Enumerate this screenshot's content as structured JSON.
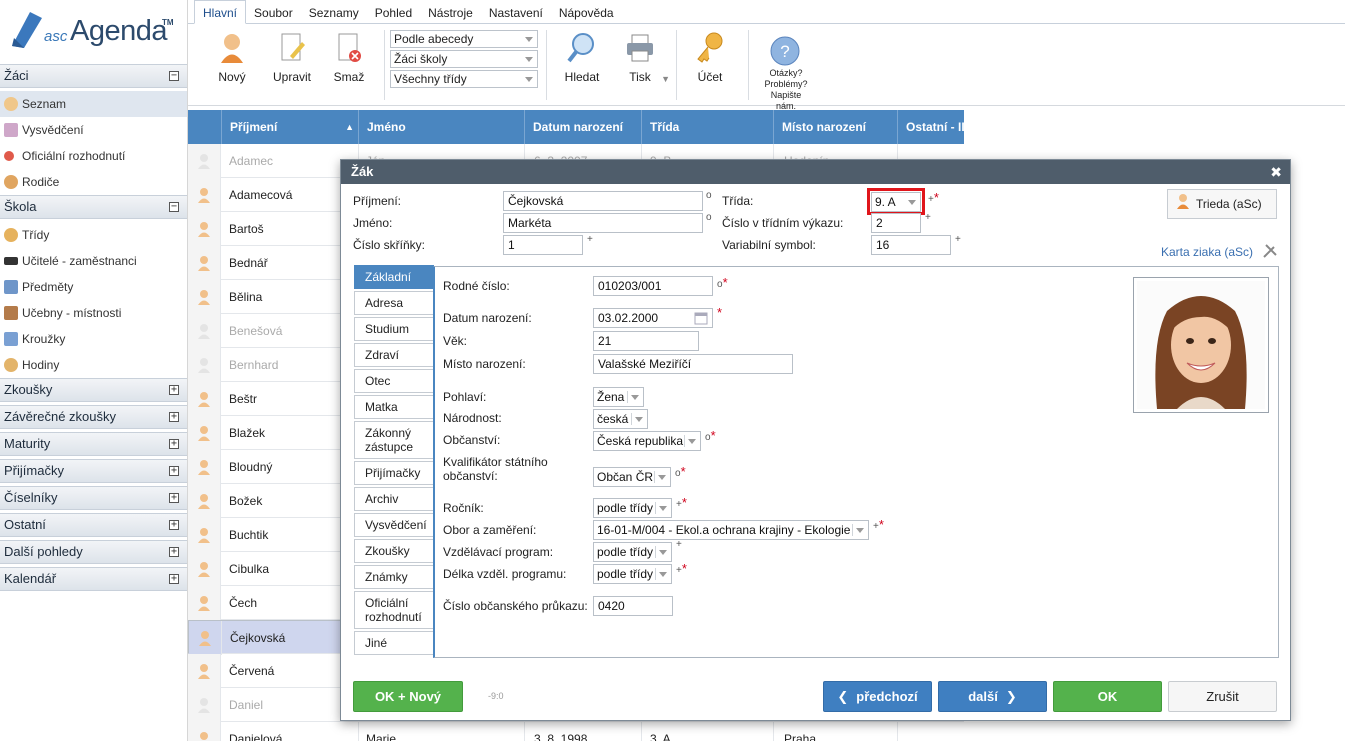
{
  "logo": {
    "prefix": "asc",
    "name": "Agenda",
    "tm": "TM"
  },
  "menu": {
    "tabs": [
      "Hlavní",
      "Soubor",
      "Seznamy",
      "Pohled",
      "Nástroje",
      "Nastavení",
      "Nápověda"
    ]
  },
  "ribbon": {
    "new": "Nový",
    "edit": "Upravit",
    "delete": "Smaž",
    "filters": [
      "Podle abecedy",
      "Žáci školy",
      "Všechny třídy"
    ],
    "search": "Hledat",
    "print": "Tisk",
    "account": "Účet",
    "help": [
      "Otázky?",
      "Problémy?",
      "Napište nám."
    ]
  },
  "sidebar": {
    "zaci": {
      "title": "Žáci",
      "toggle": "−",
      "items": [
        "Seznam",
        "Vysvědčení",
        "Oficiální rozhodnutí",
        "Rodiče"
      ]
    },
    "skola": {
      "title": "Škola",
      "toggle": "−",
      "items": [
        "Třídy",
        "Učitelé - zaměstnanci",
        "Předměty",
        "Učebny - místnosti",
        "Kroužky",
        "Hodiny"
      ]
    },
    "collapsed": [
      "Zkoušky",
      "Závěrečné zkoušky",
      "Maturity",
      "Přijímačky",
      "Číselníky",
      "Ostatní",
      "Další pohledy",
      "Kalendář"
    ],
    "expand_symbol": "+"
  },
  "grid": {
    "headers": [
      "Příjmení",
      "Jméno",
      "Datum narození",
      "Třída",
      "Místo narození",
      "Ostatní - II"
    ],
    "sort_indicator": "▲",
    "rows": [
      "Adamec",
      "Adamecová",
      "Bartoš",
      "Bednář",
      "Bělina",
      "Benešová",
      "Bernhard",
      "Beštr",
      "Blažek",
      "Bloudný",
      "Božek",
      "Buchtik",
      "Cibulka",
      "Čech",
      "Čejkovská",
      "Červená",
      "Daniel",
      "Danielová"
    ],
    "first_row_partial": [
      "Ján",
      "6. 3. 2007",
      "9. B",
      "Hodonín"
    ],
    "last_row": [
      "Marie",
      "3. 8. 1998",
      "3. A",
      "Praha"
    ]
  },
  "dialog": {
    "title": "Žák",
    "close": "✖",
    "prijmeni_label": "Příjmení:",
    "prijmeni": "Čejkovská",
    "jmeno_label": "Jméno:",
    "jmeno": "Markéta",
    "skrinka_label": "Číslo skříňky:",
    "skrinka": "1",
    "trida_label": "Třída:",
    "trida": "9. A",
    "cislo_vykaz_label": "Číslo v třídním výkazu:",
    "cislo_vykaz": "2",
    "varsym_label": "Variabilní symbol:",
    "varsym": "16",
    "trieda_btn": "Trieda (aSc)",
    "karta_link": "Karta ziaka (aSc)",
    "mark_circle": "o",
    "mark_plus": "+",
    "mark_star": "*",
    "tabs": [
      "Základní",
      "Adresa",
      "Studium",
      "Zdraví",
      "Otec",
      "Matka",
      "Zákonný zástupce",
      "Přijímačky",
      "Archiv",
      "Vysvědčení",
      "Zkoušky",
      "Známky",
      "Oficiální rozhodnutí",
      "Jiné"
    ],
    "basic": {
      "rodne_label": "Rodné číslo:",
      "rodne": "010203/001",
      "datum_label": "Datum narození:",
      "datum": "03.02.2000",
      "vek_label": "Věk:",
      "vek": "21",
      "misto_label": "Místo narození:",
      "misto": "Valašské Meziříčí",
      "pohlavi_label": "Pohlaví:",
      "pohlavi": "Žena",
      "narodnost_label": "Národnost:",
      "narodnost": "česká",
      "obcanstvi_label": "Občanství:",
      "obcanstvi": "Česká republika",
      "kvalif_label": "Kvalifikátor státního občanství:",
      "kvalif": "Občan ČR",
      "rocnik_label": "Ročník:",
      "rocnik": "podle třídy",
      "obor_label": "Obor a zaměření:",
      "obor": "16-01-M/004 - Ekol.a ochrana krajiny - Ekologie",
      "program_label": "Vzdělávací program:",
      "program": "podle třídy",
      "delka_label": "Délka vzděl. programu:",
      "delka": "podle třídy",
      "op_label": "Číslo občanského průkazu:",
      "op": "0420"
    },
    "buttons": {
      "ok_new": "OK + Nový",
      "code": "-9:0",
      "prev": "předchozí",
      "next": "další",
      "ok": "OK",
      "cancel": "Zrušit"
    }
  },
  "colors": {
    "accent": "#4a86c0",
    "highlight": "#e0151b",
    "ok": "#54b24c",
    "title": "#4f5d6b"
  }
}
